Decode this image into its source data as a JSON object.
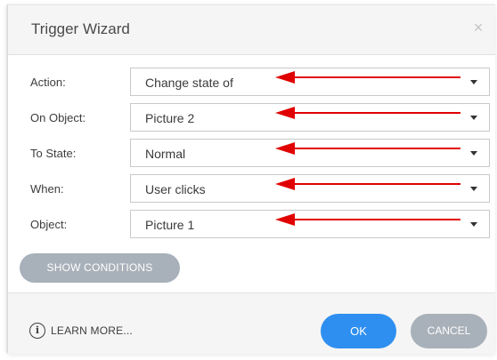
{
  "dialog": {
    "title": "Trigger Wizard",
    "close_glyph": "×"
  },
  "fields": [
    {
      "label": "Action:",
      "value": "Change state of"
    },
    {
      "label": "On Object:",
      "value": "Picture 2"
    },
    {
      "label": "To State:",
      "value": "Normal"
    },
    {
      "label": "When:",
      "value": "User clicks"
    },
    {
      "label": "Object:",
      "value": "Picture 1"
    }
  ],
  "show_conditions_label": "SHOW CONDITIONS",
  "footer": {
    "info_glyph": "i",
    "learn_more_label": "LEARN MORE...",
    "ok_label": "OK",
    "cancel_label": "CANCEL"
  },
  "colors": {
    "ok_button": "#2f8ff0",
    "secondary_button": "#a8b0b9",
    "annotation_arrow": "#e00000"
  },
  "icons": {
    "close": "close-icon",
    "caret": "chevron-down-icon",
    "info": "info-icon",
    "annotation": "red-arrow-icon"
  }
}
